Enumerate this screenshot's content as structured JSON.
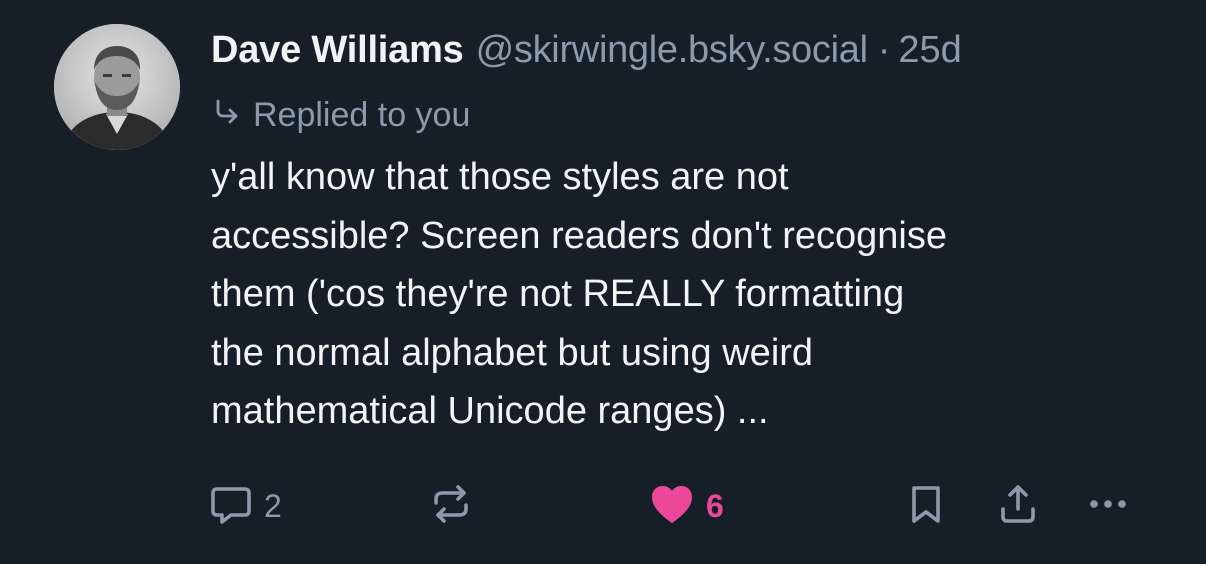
{
  "post": {
    "author": {
      "display_name": "Dave Williams",
      "handle": "@skirwingle.bsky.social"
    },
    "separator": "·",
    "timestamp": "25d",
    "reply_context": "Replied to you",
    "text_lines": [
      "y'all know that those styles are not",
      "accessible? Screen readers don't recognise",
      "them ('cos they're not REALLY formatting",
      "the normal alphabet but using weird",
      "mathematical Unicode ranges) ..."
    ],
    "actions": {
      "reply_count": "2",
      "repost_count": "",
      "like_count": "6",
      "liked": true
    },
    "icons": {
      "reply": "speech-bubble-icon",
      "repost": "repost-arrows-icon",
      "like": "heart-icon",
      "bookmark": "bookmark-icon",
      "share": "share-upload-icon",
      "more": "ellipsis-icon",
      "reply_context": "reply-arrow-icon"
    },
    "colors": {
      "background": "#161e27",
      "text": "#f1f3f5",
      "muted": "#8d9aab",
      "like": "#ec4899"
    }
  }
}
